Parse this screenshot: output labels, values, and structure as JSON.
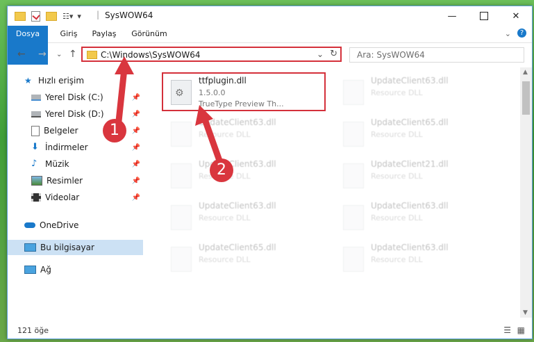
{
  "window": {
    "title": "SysWOW64"
  },
  "ribbon": {
    "tabs": [
      "Dosya",
      "Giriş",
      "Paylaş",
      "Görünüm"
    ]
  },
  "address": {
    "path": "C:\\Windows\\SysWOW64"
  },
  "search": {
    "placeholder": "Ara: SysWOW64"
  },
  "sidebar": {
    "items": [
      {
        "label": "Hızlı erişim",
        "icon": "star-icon"
      },
      {
        "label": "Yerel Disk (C:)",
        "icon": "drive-icon",
        "pinned": true
      },
      {
        "label": "Yerel Disk (D:)",
        "icon": "drive-icon",
        "pinned": true
      },
      {
        "label": "Belgeler",
        "icon": "document-icon",
        "pinned": true
      },
      {
        "label": "İndirmeler",
        "icon": "download-icon",
        "pinned": true
      },
      {
        "label": "Müzik",
        "icon": "music-icon",
        "pinned": true
      },
      {
        "label": "Resimler",
        "icon": "picture-icon",
        "pinned": true
      },
      {
        "label": "Videolar",
        "icon": "video-icon",
        "pinned": true
      },
      {
        "label": "OneDrive",
        "icon": "cloud-icon"
      },
      {
        "label": "Bu bilgisayar",
        "icon": "computer-icon",
        "selected": true
      },
      {
        "label": "Ağ",
        "icon": "network-icon"
      }
    ]
  },
  "files": [
    {
      "name": "ttfplugin.dll",
      "line2": "1.5.0.0",
      "line3": "TrueType Preview Th...",
      "highlighted": true
    },
    {
      "name": "UpdateClient63.dll",
      "line2": "Resource DLL"
    },
    {
      "name": "UpdateClient63.dll",
      "line2": "Resource DLL"
    },
    {
      "name": "UpdateClient65.dll",
      "line2": "Resource DLL"
    },
    {
      "name": "UpdateClient63.dll",
      "line2": "Resource DLL"
    },
    {
      "name": "UpdateClient21.dll",
      "line2": "Resource DLL"
    },
    {
      "name": "UpdateClient63.dll",
      "line2": "Resource DLL"
    },
    {
      "name": "UpdateClient63.dll",
      "line2": "Resource DLL"
    },
    {
      "name": "UpdateClient65.dll",
      "line2": "Resource DLL"
    },
    {
      "name": "UpdateClient63.dll",
      "line2": "Resource DLL"
    }
  ],
  "status": {
    "count": "121 öğe"
  },
  "annotations": {
    "marker1": "1",
    "marker2": "2"
  },
  "colors": {
    "accent": "#1979ca",
    "highlight": "#d4303a"
  }
}
